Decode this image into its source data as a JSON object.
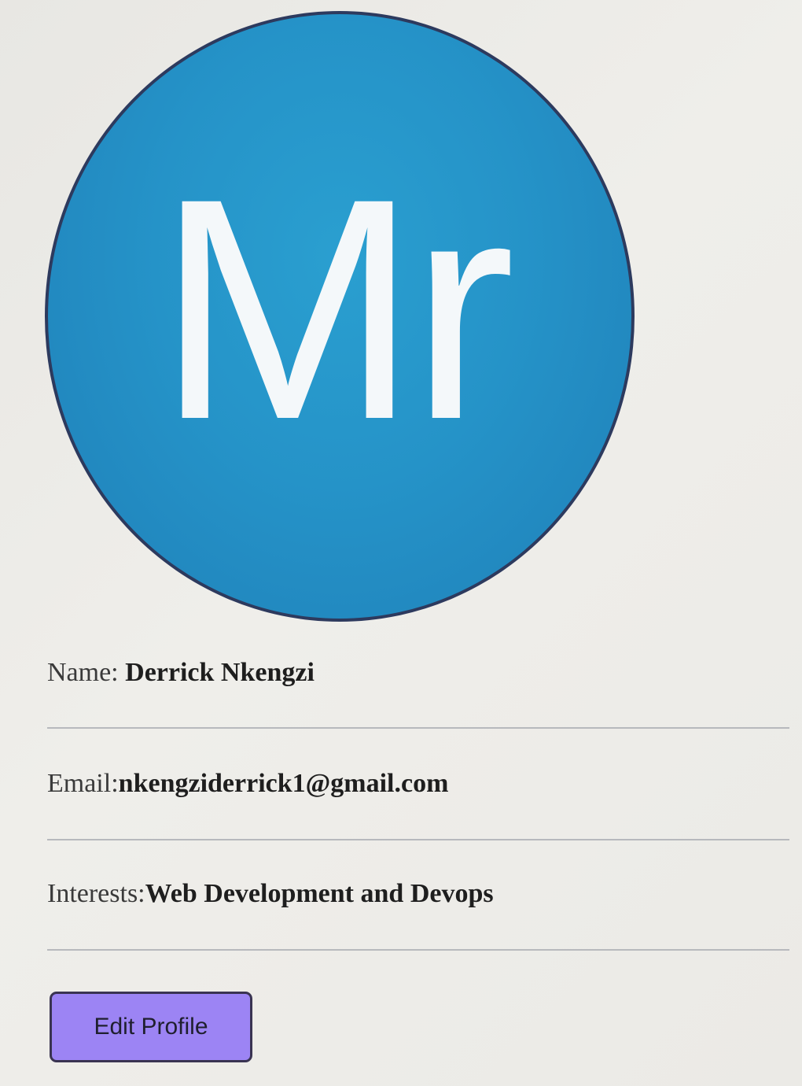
{
  "avatar": {
    "initials": "Mr",
    "background_color": "#2593c8",
    "border_color": "#2d3a5e",
    "text_color": "#f4f8fa"
  },
  "profile": {
    "name_label": "Name:",
    "name_value": "Derrick Nkengzi",
    "email_label": "Email:",
    "email_value": "nkengziderrick1@gmail.com",
    "interests_label": "Interests:",
    "interests_value": "Web Development and Devops"
  },
  "actions": {
    "edit_label": "Edit Profile",
    "edit_color": "#9c84f4"
  }
}
